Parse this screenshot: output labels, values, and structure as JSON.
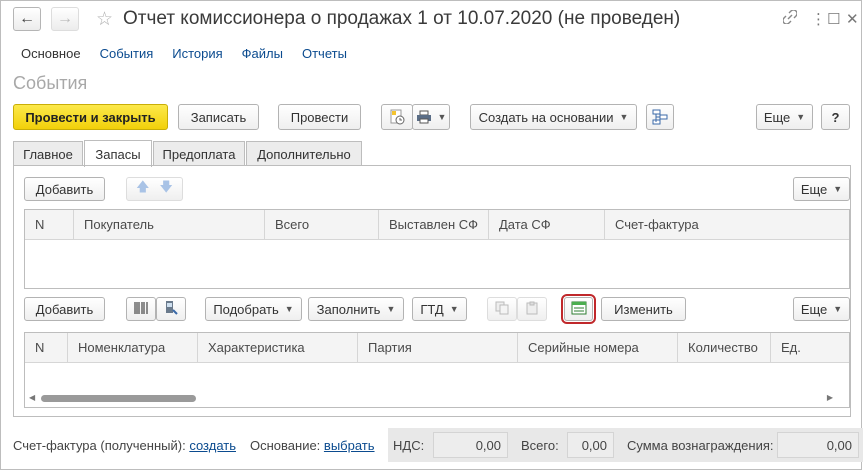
{
  "window": {
    "title": "Отчет комиссионера о продажах 1 от 10.07.2020 (не проведен)",
    "back_icon": "←",
    "forward_icon": "→",
    "star_icon": "☆",
    "link_icon": "🔗",
    "menu_icon": "⋮",
    "maximize_icon": "☐",
    "close_icon": "✕"
  },
  "nav_links": {
    "main": "Основное",
    "events": "События",
    "history": "История",
    "files": "Файлы",
    "reports": "Отчеты"
  },
  "section_title": "События",
  "toolbar": {
    "post_close": "Провести и закрыть",
    "save": "Записать",
    "post": "Провести",
    "create_based": "Создать на основании",
    "more": "Еще",
    "help": "?"
  },
  "tabs": {
    "main": "Главное",
    "stocks": "Запасы",
    "prepayment": "Предоплата",
    "additional": "Дополнительно"
  },
  "buyers": {
    "add": "Добавить",
    "more": "Еще",
    "columns": [
      "N",
      "Покупатель",
      "Всего",
      "Выставлен СФ",
      "Дата СФ",
      "Счет-фактура"
    ]
  },
  "goods": {
    "add": "Добавить",
    "pick": "Подобрать",
    "fill": "Заполнить",
    "gtd": "ГТД",
    "change": "Изменить",
    "more": "Еще",
    "columns": [
      "N",
      "Номенклатура",
      "Характеристика",
      "Партия",
      "Серийные номера",
      "Количество",
      "Ед."
    ]
  },
  "footer": {
    "invoice_label": "Счет-фактура (полученный):",
    "invoice_link": "создать",
    "basis_label": "Основание:",
    "basis_link": "выбрать",
    "vat_label": "НДС:",
    "vat_value": "0,00",
    "total_label": "Всего:",
    "total_value": "0,00",
    "fee_label": "Сумма вознаграждения:",
    "fee_value": "0,00"
  },
  "colors": {
    "primary_button": "#f2d00a",
    "link": "#0b4b8f",
    "highlight": "#c0282b"
  }
}
